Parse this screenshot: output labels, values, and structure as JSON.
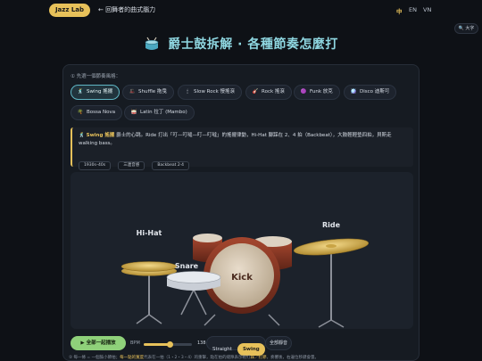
{
  "topbar": {
    "badge": "Jazz Lab",
    "back": "← 回舞者的曲式腦力",
    "languages": [
      {
        "label": "中",
        "active": true
      },
      {
        "label": "EN",
        "active": false
      },
      {
        "label": "VN",
        "active": false
      }
    ],
    "bigfont": "🔍 大字"
  },
  "page": {
    "title": "爵士鼓拆解 · 各種節奏怎麼打"
  },
  "picker": {
    "step_label": "① 先選一個節奏風格：",
    "rhythms": [
      {
        "icon": "🕺",
        "label": "Swing 搖擺",
        "active": true
      },
      {
        "icon": "🎩",
        "label": "Shuffle 拖曳",
        "active": false
      },
      {
        "icon": "🕯",
        "label": "Slow Rock 慢搖滾",
        "active": false
      },
      {
        "icon": "🎸",
        "label": "Rock 搖滾",
        "active": false
      },
      {
        "icon": "🟣",
        "label": "Funk 放克",
        "active": false
      },
      {
        "icon": "🪩",
        "label": "Disco 迪斯可",
        "active": false
      },
      {
        "icon": "🌴",
        "label": "Bossa Nova",
        "active": false
      },
      {
        "icon": "🥁",
        "label": "Latin 拉丁 (Mambo)",
        "active": false
      }
    ]
  },
  "description": {
    "icon": "🕺",
    "name": "Swing 搖擺",
    "text": "爵士的心跳。Ride 打出「叮—叮噠—叮—叮噠」的搖擺律動，Hi-Hat 腳踩在 2、4 拍（Backbeat），大鼓輕輕墊四拍，貝斯走 walking bass。",
    "tags": [
      "1930s–40s",
      "三連音感",
      "Backbeat 2·4"
    ]
  },
  "stage": {
    "labels": {
      "hihat": "Hi-Hat",
      "snare": "Snare",
      "kick": "Kick",
      "ride": "Ride"
    }
  },
  "controls": {
    "play": "▶ 全部一起播放",
    "bpm_label": "BPM",
    "bpm_value": "138",
    "bpm_fraction": 0.55,
    "feel_options": [
      {
        "label": "Straight",
        "active": false
      },
      {
        "label": "Swing",
        "active": true
      }
    ],
    "mute": "全部靜音"
  },
  "hint": {
    "prefix": "② 每一條 = 一個鼓小節拍；",
    "highlight1": "每一點的寬度",
    "middle": "代表在一拍（1・2・3・4）的重擊，點在拍的縫隙表示輕打",
    "highlight2": "踩／打節",
    "suffix": "，奏響後，右邊位移鍵會量。"
  },
  "colors": {
    "accent": "#e7c15a",
    "title": "#8ed6e0",
    "play": "#8fd17a",
    "active_border": "#5fb6c4"
  }
}
